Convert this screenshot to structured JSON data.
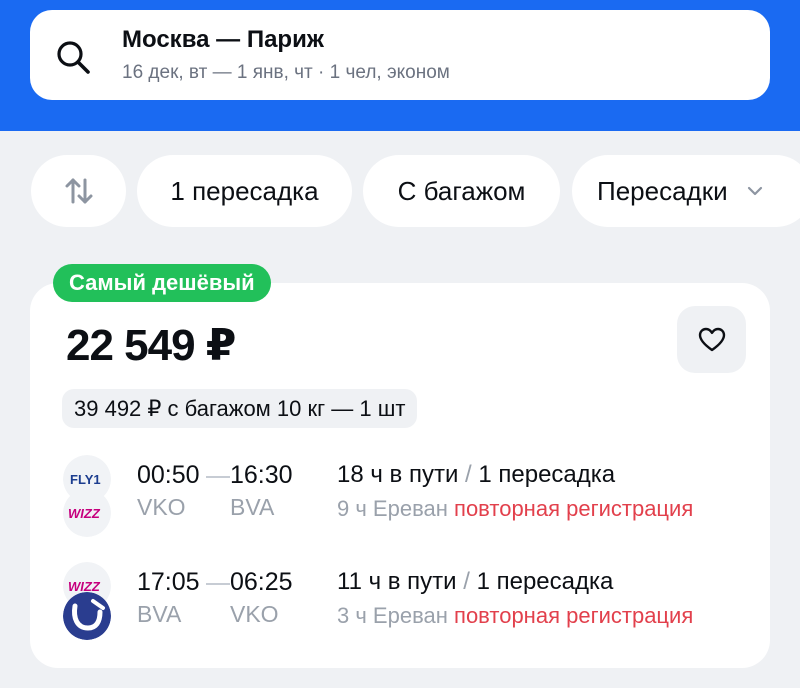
{
  "search": {
    "title": "Москва — Париж",
    "subtitle": "16 дек, вт — 1 янв, чт · 1 чел, эконом"
  },
  "filters": {
    "sort_icon": "sort-arrows-icon",
    "transfers": "1 пересадка",
    "baggage": "С багажом",
    "stops": "Пересадки"
  },
  "offer": {
    "badge": "Самый дешёвый",
    "price": "22 549 ₽",
    "baggage_price": "39 492 ₽ с багажом 10 кг — 1 шт",
    "legs": [
      {
        "airlines": [
          "FlyOne",
          "Wizz Air"
        ],
        "dep_time": "00:50",
        "arr_time": "16:30",
        "dep_code": "VKO",
        "arr_code": "BVA",
        "duration": "18 ч в пути",
        "transfers": "1 пересадка",
        "stop_city": "9 ч Ереван",
        "stop_note": "повторная регистрация"
      },
      {
        "airlines": [
          "Wizz Air",
          "Utair"
        ],
        "dep_time": "17:05",
        "arr_time": "06:25",
        "dep_code": "BVA",
        "arr_code": "VKO",
        "duration": "11 ч в пути",
        "transfers": "1 пересадка",
        "stop_city": "3 ч Ереван",
        "stop_note": "повторная регистрация"
      }
    ]
  },
  "logo_text": {
    "flyone": "FLY1",
    "wizz": "WIZZ"
  },
  "colors": {
    "brand_blue": "#1a6af2",
    "badge_green": "#22c05a",
    "warning_red": "#e2404c",
    "wizz_pink": "#c6007e",
    "flyone_blue": "#1c3d8f",
    "utair_blue": "#2a3d8f"
  }
}
